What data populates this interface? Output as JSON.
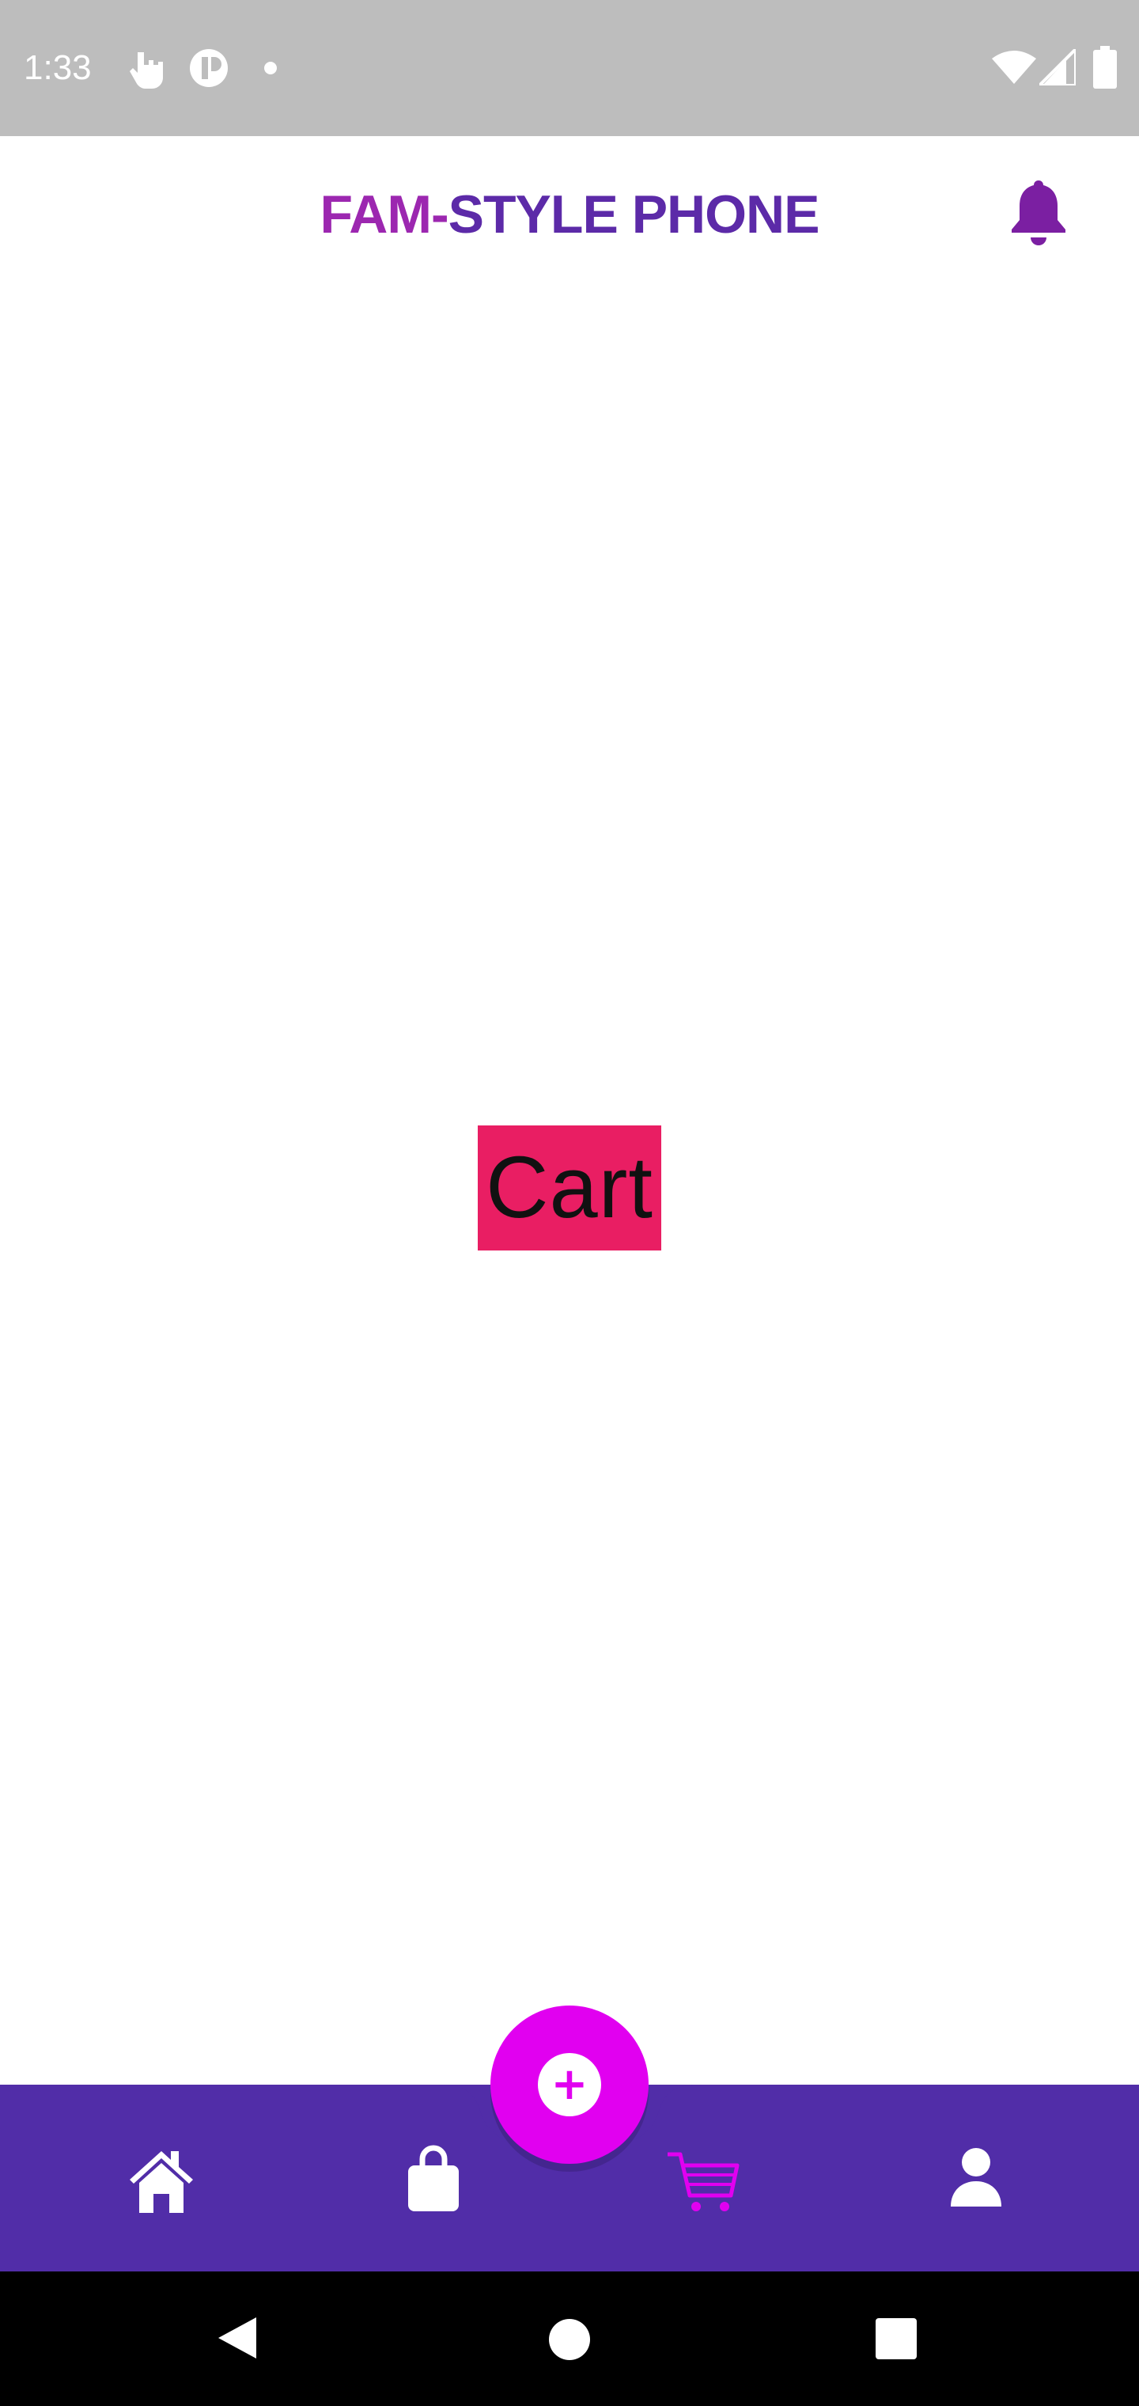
{
  "status_bar": {
    "time": "1:33",
    "icons": [
      "touch-icon",
      "app-icon",
      "dot-icon",
      "wifi-icon",
      "signal-icon",
      "battery-icon"
    ]
  },
  "app_bar": {
    "title_part1": "FAM-",
    "title_part2": "STYLE PHONE",
    "notification_icon": "bell-icon"
  },
  "content": {
    "label": "Cart"
  },
  "bottom_nav": {
    "items": [
      "home-icon",
      "shopping-bag-icon",
      "cart-icon",
      "profile-icon"
    ],
    "active": "cart-icon",
    "fab_icon": "plus-icon",
    "fab_symbol": "+"
  },
  "system_nav": {
    "buttons": [
      "back-icon",
      "home-circle-icon",
      "recents-icon"
    ]
  },
  "colors": {
    "status_bar": "#bdbdbd",
    "title_accent": "#9c27b0",
    "title_primary": "#5c2aa8",
    "nav_background": "#512da8",
    "fab": "#e100f0",
    "cart_label_bg": "#e91e63",
    "active_nav_icon": "#e100f0"
  }
}
